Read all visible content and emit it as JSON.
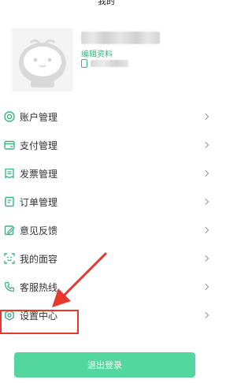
{
  "header": {
    "title": "我的"
  },
  "profile": {
    "name": "",
    "edit_label": "编辑资料",
    "phone": ""
  },
  "menu": {
    "items": [
      {
        "label": "账户管理",
        "icon": "account-icon"
      },
      {
        "label": "支付管理",
        "icon": "payment-icon"
      },
      {
        "label": "发票管理",
        "icon": "invoice-icon"
      },
      {
        "label": "订单管理",
        "icon": "order-icon"
      },
      {
        "label": "意见反馈",
        "icon": "feedback-icon"
      },
      {
        "label": "我的面容",
        "icon": "face-scan-icon"
      },
      {
        "label": "客服热线",
        "icon": "phone-icon"
      },
      {
        "label": "设置中心",
        "icon": "settings-icon"
      }
    ]
  },
  "logout": {
    "label": "退出登录"
  },
  "colors": {
    "accent": "#39b57e",
    "button": "#4bd59a",
    "annotation": "#e8372c"
  }
}
